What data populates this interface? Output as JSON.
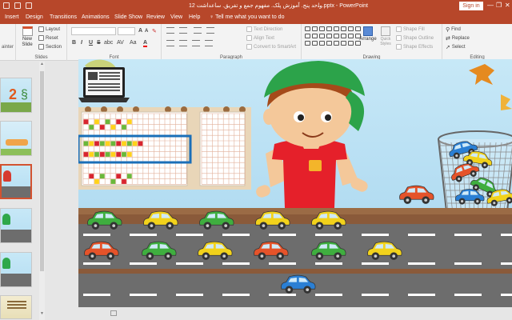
{
  "window": {
    "title": "12 ﻭﻠﺣﺪ ﭘﻨﺞ. ﺁﻣﻮﺯﺵ ﭘﻠﮏ. ﻣﻔﻬﻮﻡ ﺟﻤﻊ ﻭ ﺗﻔﺮﯾﻖ. ﺳﺎﻋﺪﺍﺷﺖ.pptx - PowerPoint",
    "signin": "Sign in",
    "minimize": "—",
    "restore": "❐",
    "close": "✕"
  },
  "tabs": [
    "Insert",
    "Design",
    "Transitions",
    "Animations",
    "Slide Show",
    "Review",
    "View",
    "Help"
  ],
  "tell_me": "Tell me what you want to do",
  "ribbon": {
    "clipboard_label": "ainter",
    "slides": {
      "label": "Slides",
      "new_slide": "New Slide",
      "layout": "Layout",
      "reset": "Reset",
      "section": "Section"
    },
    "font": {
      "label": "Font",
      "font_name": "",
      "font_size": "",
      "bold": "B",
      "italic": "I",
      "underline": "U",
      "strike": "S",
      "shadow": "abc",
      "spacing": "AV",
      "case": "Aa",
      "color": "A",
      "grow": "A",
      "shrink": "A"
    },
    "paragraph": {
      "label": "Paragraph",
      "text_direction": "Text Direction",
      "align_text": "Align Text",
      "convert_smartart": "Convert to SmartArt"
    },
    "drawing": {
      "label": "Drawing",
      "arrange": "Arrange",
      "quick_styles": "Quick Styles",
      "shape_fill": "Shape Fill",
      "shape_outline": "Shape Outline",
      "shape_effects": "Shape Effects"
    },
    "editing": {
      "label": "Editing",
      "find": "Find",
      "replace": "Replace",
      "select": "Select"
    }
  },
  "colors": {
    "accent": "#b7472a",
    "sky": "#b9e0f3",
    "road": "#6d6d6d",
    "dirt": "#8a5a3a",
    "grid_yellow": "#ffd21a",
    "grid_green": "#6ab83a",
    "grid_red": "#d8242f",
    "highlight": "#1a6fb8"
  },
  "slide": {
    "road_top_row_cars": [
      "green",
      "yellow",
      "green",
      "yellow",
      "yellow"
    ],
    "road_mid_row_cars": [
      "orange",
      "green",
      "yellow",
      "orange",
      "green",
      "yellow"
    ],
    "road_bottom_row_cars": [
      "blue"
    ],
    "basket_cars": [
      "blue",
      "yellow",
      "orange",
      "green",
      "blue",
      "yellow"
    ],
    "standing_car": "orange"
  }
}
